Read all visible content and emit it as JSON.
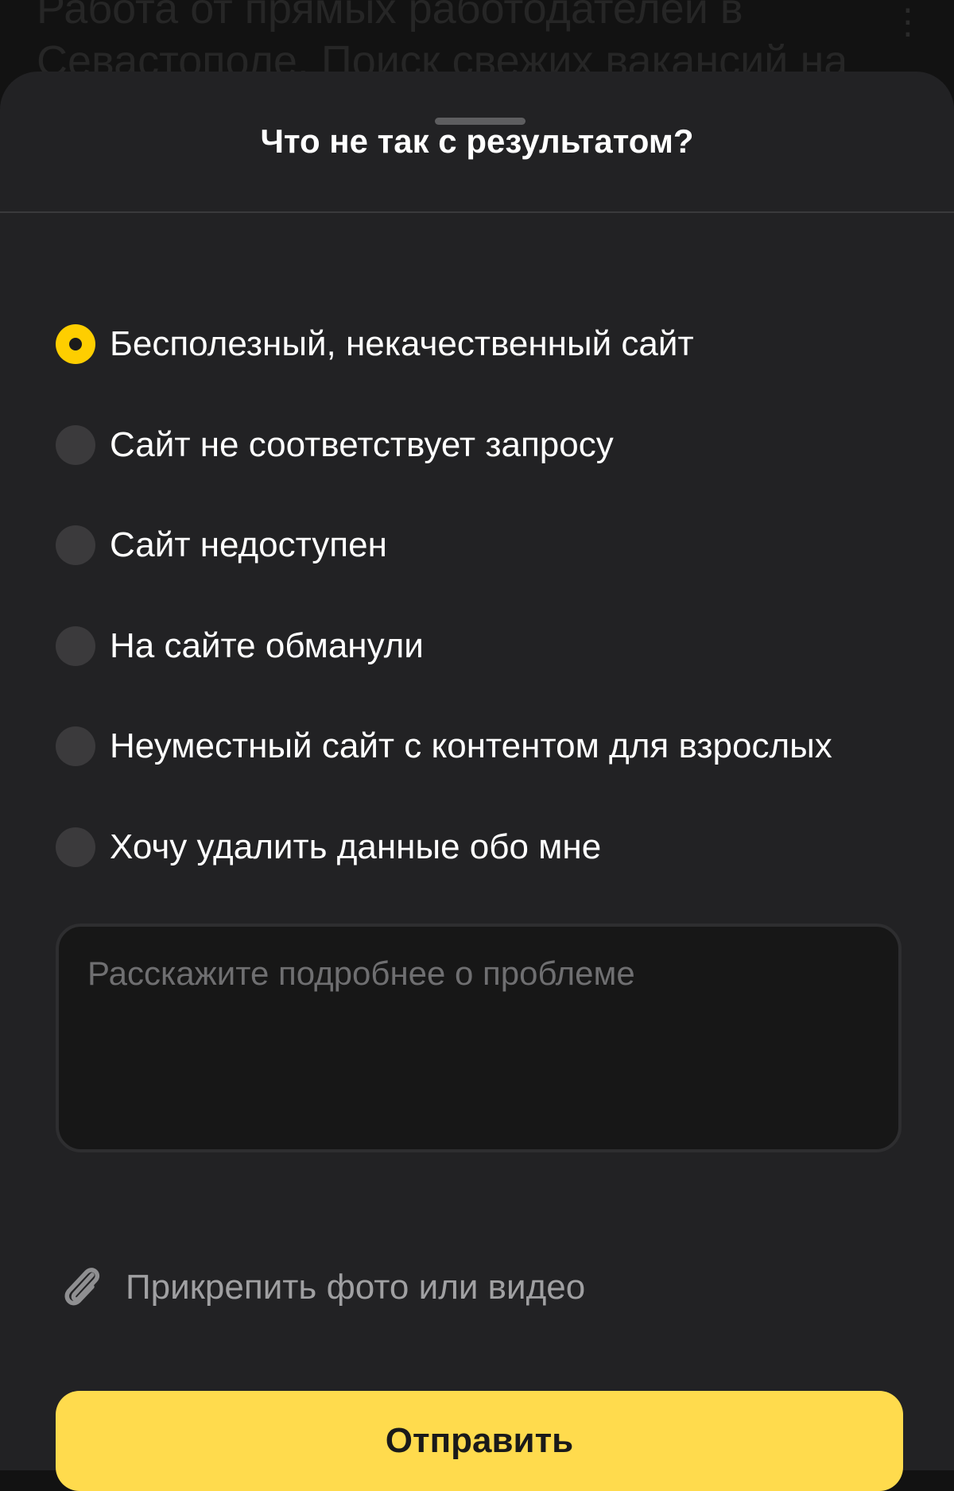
{
  "background": {
    "page_title": "Работа от прямых работодателей в Севастополе. Поиск свежих вакансий на",
    "more_icon": "more-vertical-icon"
  },
  "dialog": {
    "title": "Что не так с результатом?",
    "options": [
      {
        "label": "Бесполезный, некачественный сайт",
        "selected": true
      },
      {
        "label": "Сайт не соответствует запросу",
        "selected": false
      },
      {
        "label": "Сайт недоступен",
        "selected": false
      },
      {
        "label": "На сайте обманули",
        "selected": false
      },
      {
        "label": "Неуместный сайт с контентом для взрослых",
        "selected": false
      },
      {
        "label": "Хочу удалить данные обо мне",
        "selected": false
      }
    ],
    "details": {
      "value": "",
      "placeholder": "Расскажите подробнее о проблеме"
    },
    "attach": {
      "label": "Прикрепить фото или видео",
      "icon": "paperclip-icon"
    },
    "submit_label": "Отправить"
  },
  "colors": {
    "sheet_bg": "#222224",
    "accent_radio": "#fece00",
    "submit_bg": "#ffdb4d",
    "text_primary": "#ffffff",
    "text_muted": "#a0a0a2"
  }
}
